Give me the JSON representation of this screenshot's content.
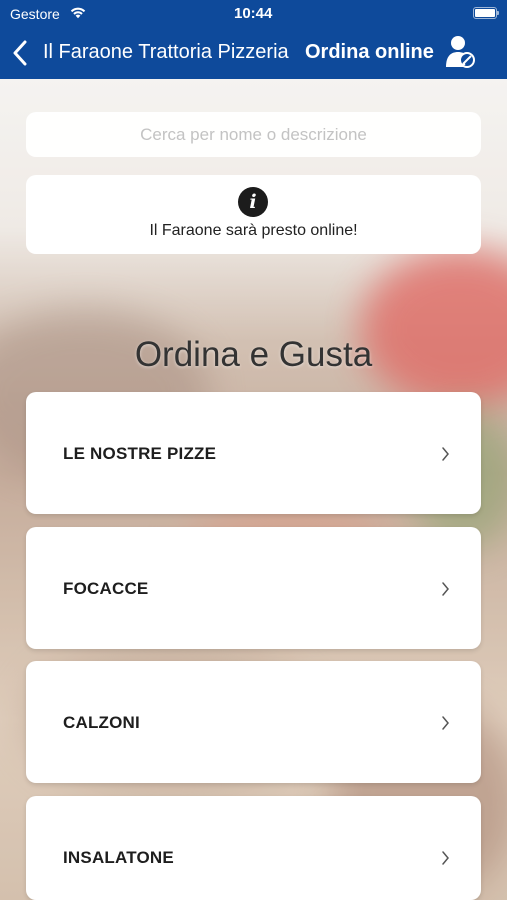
{
  "status_bar": {
    "carrier": "Gestore",
    "time": "10:44",
    "wifi_icon": "wifi-icon",
    "battery_icon": "battery-icon",
    "battery_level": 1.0
  },
  "nav": {
    "back_icon": "chevron-left-icon",
    "title": "Il Faraone Trattoria Pizzeria",
    "right_title": "Ordina online",
    "user_icon": "user-icon"
  },
  "search": {
    "placeholder": "Cerca per nome o descrizione"
  },
  "info": {
    "icon": "info-icon",
    "glyph": "i",
    "message": "Il Faraone sarà presto online!"
  },
  "heading": "Ordina e Gusta",
  "categories": [
    {
      "label": "LE NOSTRE PIZZE"
    },
    {
      "label": "FOCACCE"
    },
    {
      "label": "CALZONI"
    },
    {
      "label": "INSALATONE"
    }
  ],
  "colors": {
    "nav_background": "#0e4a9b",
    "card_background": "#ffffff",
    "text_dark": "#1e1e1e"
  }
}
